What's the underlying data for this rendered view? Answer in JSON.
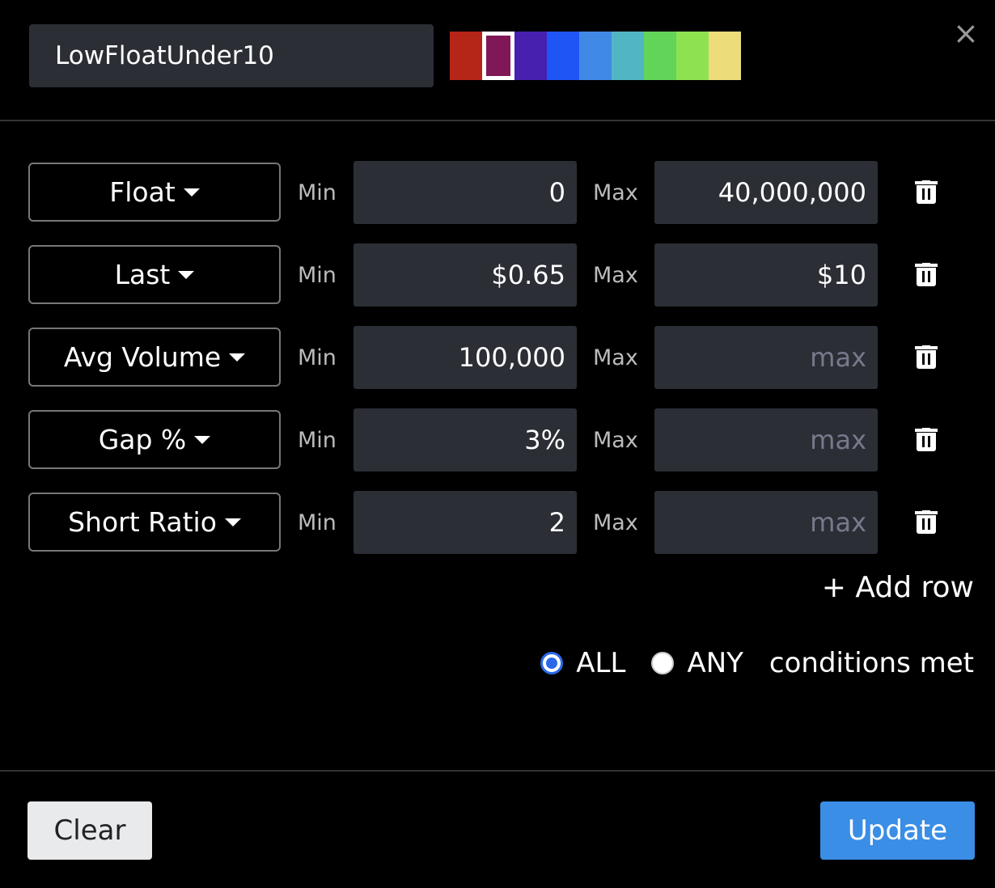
{
  "filter_name": "LowFloatUnder10",
  "colors": [
    "#b52518",
    "#801858",
    "#4720b0",
    "#2055f5",
    "#408ae6",
    "#52b5c4",
    "#62d45a",
    "#8ee250",
    "#ecdc7a"
  ],
  "selected_color_index": 1,
  "close_label": "×",
  "min_label": "Min",
  "max_label": "Max",
  "rows": [
    {
      "field": "Float",
      "min": "0",
      "max": "40,000,000",
      "max_placeholder": "max"
    },
    {
      "field": "Last",
      "min": "$0.65",
      "max": "$10",
      "max_placeholder": "max"
    },
    {
      "field": "Avg Volume",
      "min": "100,000",
      "max": "",
      "max_placeholder": "max"
    },
    {
      "field": "Gap %",
      "min": "3%",
      "max": "",
      "max_placeholder": "max"
    },
    {
      "field": "Short Ratio",
      "min": "2",
      "max": "",
      "max_placeholder": "max"
    }
  ],
  "add_row_label": "+ Add row",
  "match": {
    "selected": "ALL",
    "all_label": "ALL",
    "any_label": "ANY",
    "suffix": "conditions met"
  },
  "clear_label": "Clear",
  "update_label": "Update",
  "update_color": "#3a8ee6"
}
